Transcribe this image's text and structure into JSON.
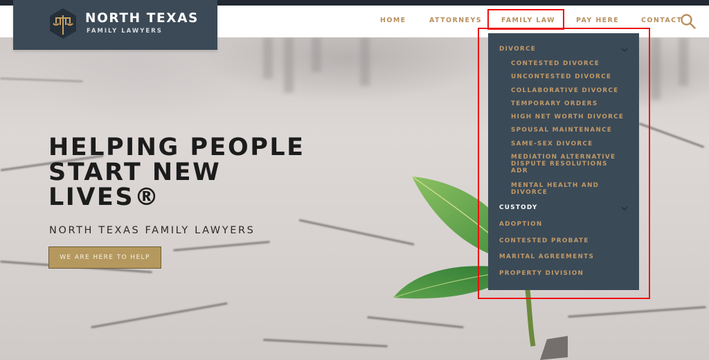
{
  "logo": {
    "title": "NORTH TEXAS",
    "subtitle": "FAMILY LAWYERS",
    "icon": "scales-of-justice-icon"
  },
  "nav": {
    "items": [
      {
        "label": "HOME"
      },
      {
        "label": "ATTORNEYS"
      },
      {
        "label": "FAMILY LAW",
        "active": true
      },
      {
        "label": "PAY HERE"
      },
      {
        "label": "CONTACT"
      }
    ],
    "search_icon": "search-icon"
  },
  "dropdown": {
    "sections": [
      {
        "label": "DIVORCE",
        "expanded": true,
        "children": [
          "CONTESTED DIVORCE",
          "UNCONTESTED DIVORCE",
          "COLLABORATIVE DIVORCE",
          "TEMPORARY ORDERS",
          "HIGH NET WORTH DIVORCE",
          "SPOUSAL MAINTENANCE",
          "SAME-SEX DIVORCE",
          "MEDIATION ALTERNATIVE DISPUTE RESOLUTIONS ADR",
          "MENTAL HEALTH AND DIVORCE"
        ]
      },
      {
        "label": "CUSTODY",
        "expanded": false
      },
      {
        "label": "ADOPTION"
      },
      {
        "label": "CONTESTED PROBATE"
      },
      {
        "label": "MARITAL AGREEMENTS"
      },
      {
        "label": "PROPERTY DIVISION"
      }
    ],
    "mediation_lines": [
      "MEDIATION ALTERNATIVE",
      "DISPUTE RESOLUTIONS",
      "ADR"
    ],
    "mental_health_lines": [
      "MENTAL HEALTH AND",
      "DIVORCE"
    ]
  },
  "hero": {
    "title_lines": [
      "HELPING PEOPLE",
      "START NEW",
      "LIVES®"
    ],
    "subtitle": "NORTH TEXAS FAMILY LAWYERS",
    "cta_label": "WE ARE HERE TO HELP"
  },
  "colors": {
    "brand_dark": "#3b4a57",
    "gold": "#b8905f",
    "button_gold": "#b5985e",
    "highlight_red": "#f00d0d"
  }
}
